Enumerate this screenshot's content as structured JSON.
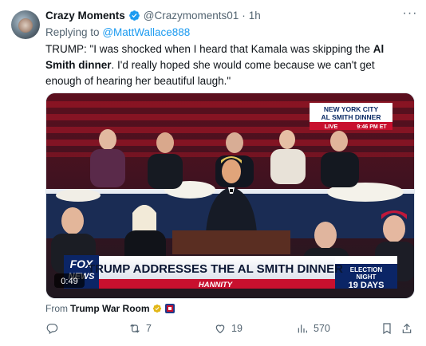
{
  "tweet": {
    "author_name": "Crazy Moments",
    "author_handle": "@Crazymoments01",
    "separator": "·",
    "time": "1h",
    "replying_prefix": "Replying to",
    "replying_to": "@MattWallace888",
    "text_part1": "TRUMP: \"I was shocked when I heard that Kamala was skipping the ",
    "text_bold": "Al Smith dinner",
    "text_part2": ". I'd really hoped she would come because we can't get enough of hearing her beautiful laugh.\""
  },
  "video": {
    "duration": "0:49",
    "bug_line1": "NEW YORK CITY",
    "bug_line2": "AL SMITH DINNER",
    "bug_live": "LIVE",
    "bug_time": "9:46 PM ET",
    "logo_line1": "FOX",
    "logo_line2": "NEWS",
    "chyron": "TRUMP ADDRESSES THE AL SMITH DINNER",
    "show": "HANNITY",
    "election_top": "ELECTION",
    "election_mid": "NIGHT",
    "election_days": "19 DAYS"
  },
  "source": {
    "prefix": "From",
    "name": "Trump War Room"
  },
  "actions": {
    "replies": "",
    "retweets": "7",
    "likes": "19",
    "views": "570"
  },
  "colors": {
    "accent": "#1d9bf0",
    "secondary_text": "#536471",
    "primary_text": "#0f1419"
  }
}
